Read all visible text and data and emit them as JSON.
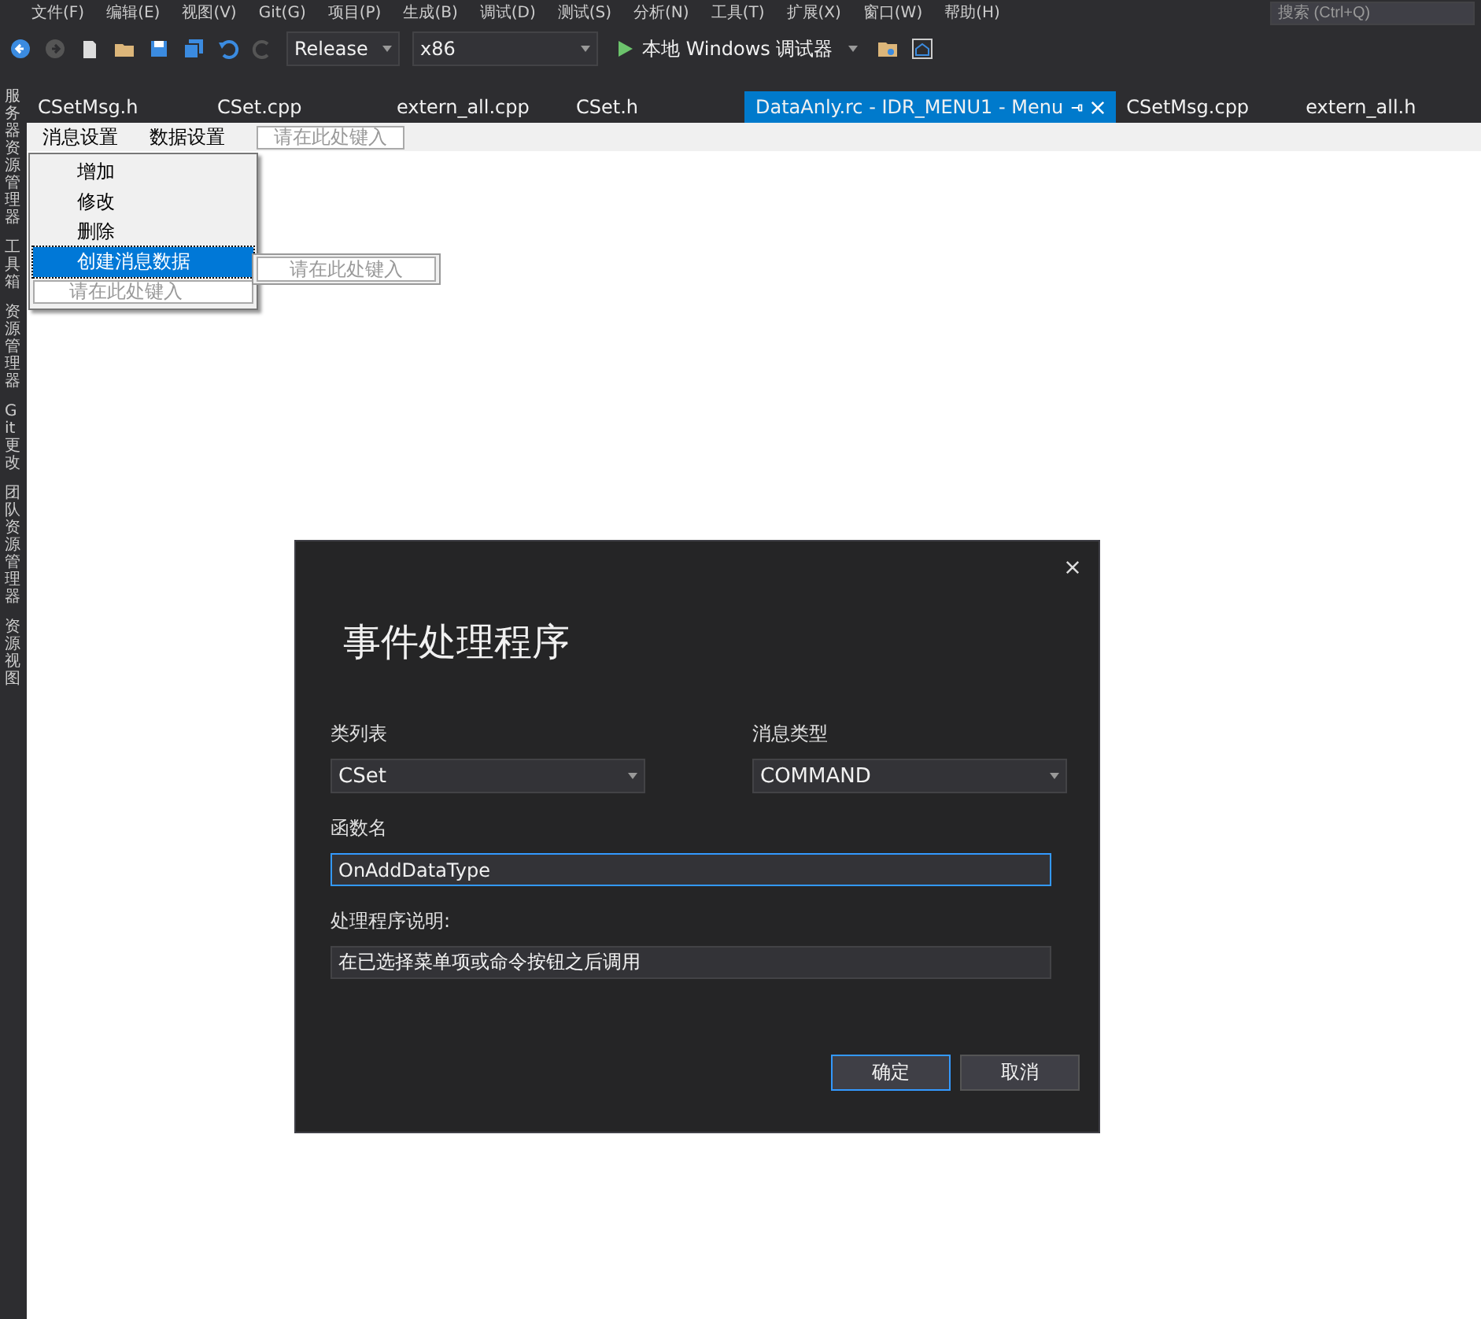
{
  "menu_bar": {
    "items": [
      "文件(F)",
      "编辑(E)",
      "视图(V)",
      "Git(G)",
      "项目(P)",
      "生成(B)",
      "调试(D)",
      "测试(S)",
      "分析(N)",
      "工具(T)",
      "扩展(X)",
      "窗口(W)",
      "帮助(H)"
    ],
    "search": {
      "placeholder": "搜索 (Ctrl+Q)"
    }
  },
  "toolbar": {
    "configuration": "Release",
    "platform": "x86",
    "run_label": "本地 Windows 调试器"
  },
  "side_panel": {
    "tabs": [
      "服务器资源管理器",
      "工具箱",
      "资源管理器",
      "Git 更改",
      "团队资源管理器",
      "资源视图"
    ]
  },
  "document_tabs": [
    {
      "label": "CSetMsg.h",
      "selected": false
    },
    {
      "label": "CSet.cpp",
      "selected": false
    },
    {
      "label": "extern_all.cpp",
      "selected": false
    },
    {
      "label": "CSet.h",
      "selected": false
    },
    {
      "label": "DataAnly.rc - IDR_MENU1 - Menu",
      "selected": true
    },
    {
      "label": "CSetMsg.cpp",
      "selected": false
    },
    {
      "label": "extern_all.h",
      "selected": false
    }
  ],
  "menu_designer": {
    "top_items": [
      "消息设置",
      "数据设置"
    ],
    "new_item_hint": "请在此处键入",
    "dropdown": [
      {
        "label": "增加",
        "selected": false
      },
      {
        "label": "修改",
        "selected": false
      },
      {
        "label": "删除",
        "selected": false
      },
      {
        "label": "创建消息数据",
        "selected": true
      }
    ],
    "dropdown_hint": "请在此处键入",
    "submenu_hint": "请在此处键入"
  },
  "dialog": {
    "title": "事件处理程序",
    "class_list_label": "类列表",
    "class_list_value": "CSet",
    "message_type_label": "消息类型",
    "message_type_value": "COMMAND",
    "function_name_label": "函数名",
    "function_name_value": "OnAddDataType",
    "description_label": "处理程序说明:",
    "description_value": "在已选择菜单项或命令按钮之后调用",
    "buttons": [
      "确定",
      "取消"
    ]
  }
}
